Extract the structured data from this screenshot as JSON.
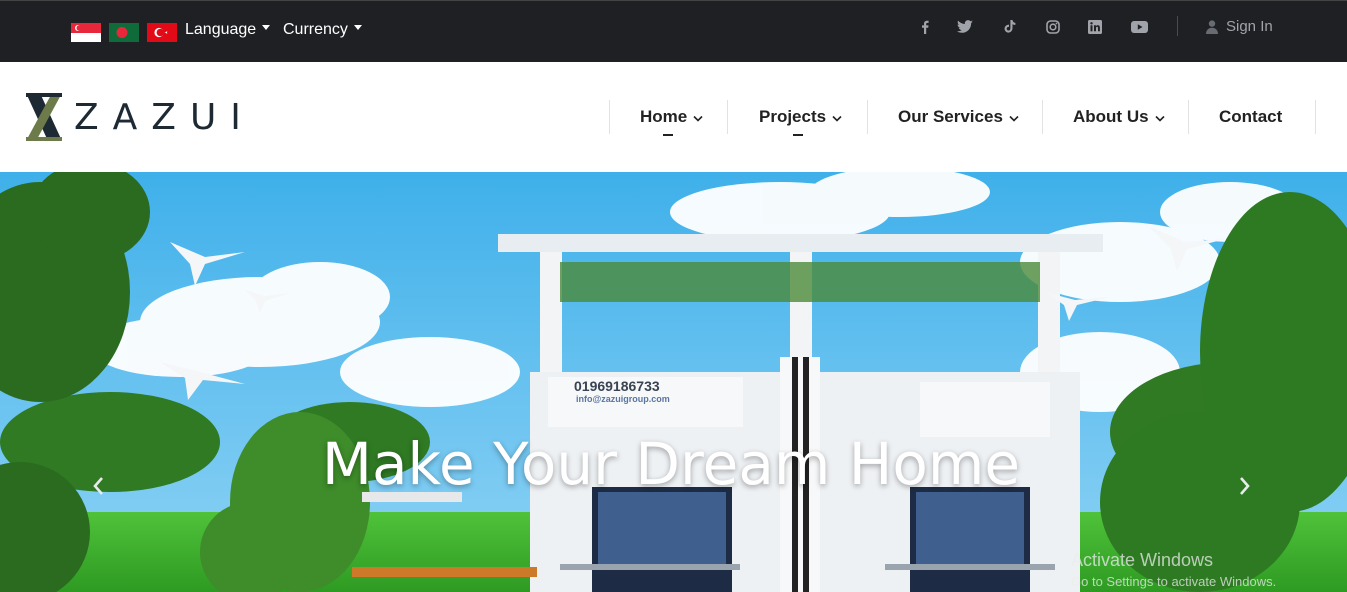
{
  "topbar": {
    "flags": [
      {
        "name": "singapore",
        "icon": "flag-singapore-icon"
      },
      {
        "name": "bangladesh",
        "icon": "flag-bangladesh-icon"
      },
      {
        "name": "turkey",
        "icon": "flag-turkey-icon"
      }
    ],
    "language_label": "Language",
    "currency_label": "Currency",
    "social": [
      "facebook-icon",
      "twitter-icon",
      "tiktok-icon",
      "instagram-icon",
      "linkedin-icon",
      "youtube-icon"
    ],
    "signin_label": "Sign In",
    "colors": {
      "bg": "#1f2024",
      "text": "#ffffff",
      "muted": "#a0a3a9"
    }
  },
  "nav": {
    "logo_text": "ZAZUI",
    "items": [
      {
        "label": "Home",
        "has_dropdown": true
      },
      {
        "label": "Projects",
        "has_dropdown": true
      },
      {
        "label": "Our Services",
        "has_dropdown": true
      },
      {
        "label": "About Us",
        "has_dropdown": true
      },
      {
        "label": "Contact",
        "has_dropdown": false
      }
    ]
  },
  "hero": {
    "title": "Make Your Dream Home",
    "sign_phone": "01969186733",
    "sign_email": "info@zazuigroup.com",
    "prev_icon": "chevron-left-icon",
    "next_icon": "chevron-right-icon"
  },
  "os_overlay": {
    "title": "Activate Windows",
    "subtitle": "Go to Settings to activate Windows."
  }
}
